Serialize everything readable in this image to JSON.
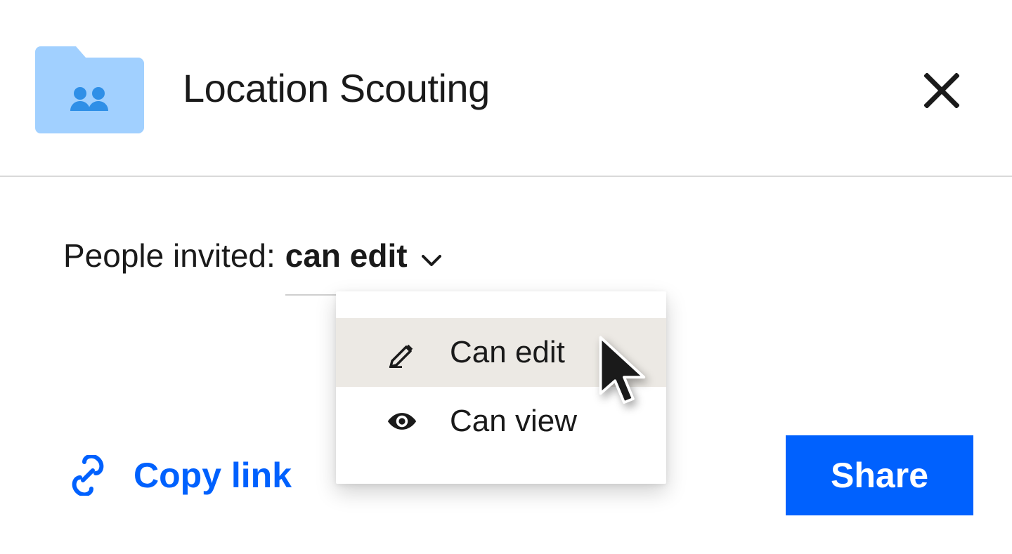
{
  "header": {
    "title": "Location Scouting"
  },
  "invite": {
    "label": "People invited:",
    "selected": "can edit"
  },
  "dropdown": {
    "options": [
      {
        "label": "Can edit"
      },
      {
        "label": "Can view"
      }
    ]
  },
  "footer": {
    "copy_link": "Copy link",
    "share": "Share"
  },
  "colors": {
    "accent": "#0061fe",
    "folder": "#a1d0ff",
    "folder_tab": "#a1d0ff",
    "folder_people": "#2f8fe7"
  }
}
